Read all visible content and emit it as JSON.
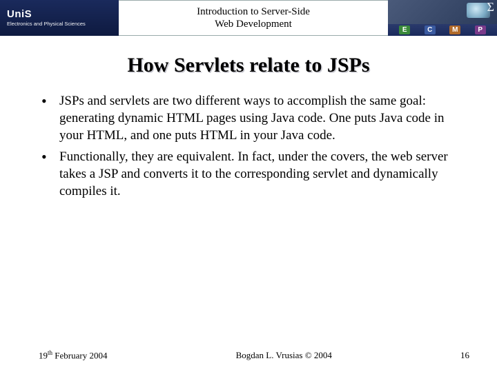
{
  "header": {
    "logo_main": "UniS",
    "logo_sub": "Electronics and\nPhysical Sciences",
    "course_title_line1": "Introduction to Server-Side",
    "course_title_line2": "Web Development",
    "badges": {
      "e": "E",
      "c": "C",
      "m": "M",
      "p": "P"
    }
  },
  "slide": {
    "title": "How Servlets relate to JSPs",
    "bullets": [
      "JSPs and servlets are two different ways to accomplish the same goal: generating dynamic HTML pages using Java code. One puts Java code in your HTML, and one puts HTML in your Java code.",
      "Functionally, they are equivalent. In fact, under the covers, the web server takes a JSP and converts it to the corresponding servlet and dynamically compiles it."
    ]
  },
  "footer": {
    "date_day": "19",
    "date_suffix": "th",
    "date_rest": " February 2004",
    "author": "Bogdan L. Vrusias © 2004",
    "page_number": "16"
  }
}
